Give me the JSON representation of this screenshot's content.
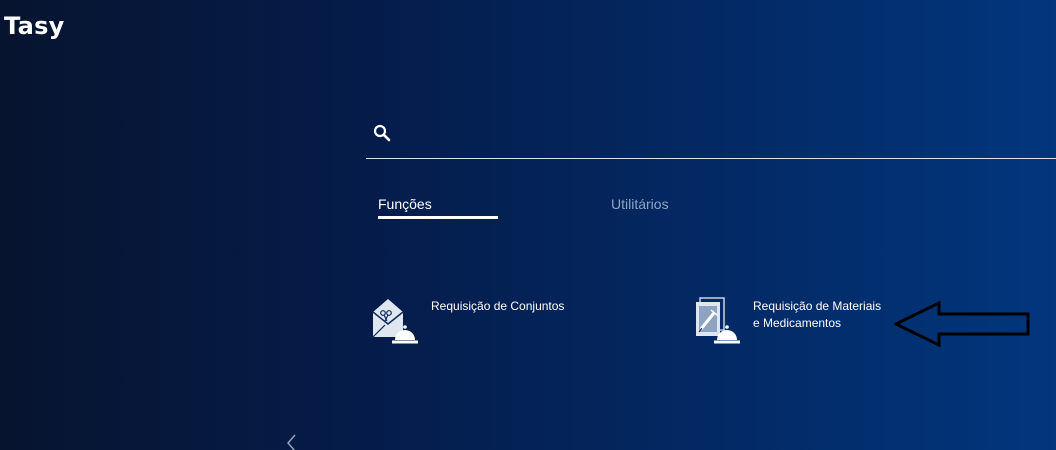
{
  "app": {
    "title": "Tasy"
  },
  "search": {
    "placeholder": "",
    "value": "",
    "icon": "search-icon"
  },
  "tabs": [
    {
      "label": "Funções",
      "active": true
    },
    {
      "label": "Utilitários",
      "active": false
    }
  ],
  "functions": [
    {
      "label": "Requisição de Conjuntos",
      "icon": "envelope-scissors-bell-icon"
    },
    {
      "label_line1": "Requisição de Materiais",
      "label_line2": "e Medicamentos",
      "icon": "document-syringe-bell-icon"
    }
  ],
  "annotation": {
    "icon": "arrow-left-outline-icon"
  },
  "sidebar": {
    "collapse_icon": "chevron-left-icon"
  },
  "colors": {
    "background_start": "#06142f",
    "background_end": "#02367d",
    "text": "#ffffff",
    "inactive_tab": "#8fa3c4"
  }
}
